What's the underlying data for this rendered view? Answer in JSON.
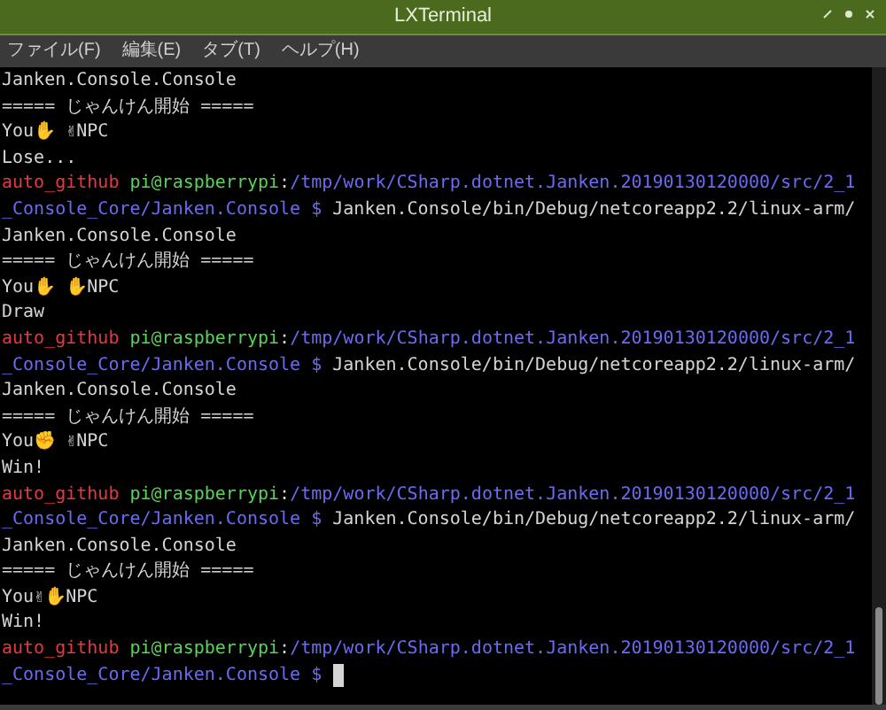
{
  "window": {
    "title": "LXTerminal"
  },
  "menu": [
    "ファイル(F)",
    "編集(E)",
    "タブ(T)",
    "ヘルプ(H)"
  ],
  "terminal": {
    "cursor": true,
    "lines": [
      [
        {
          "kind": "output",
          "text": "Janken.Console.Console"
        }
      ],
      [
        {
          "kind": "output",
          "text": "===== じゃんけん開始 ====="
        }
      ],
      [
        {
          "kind": "output",
          "text": "You✋ ✌NPC"
        }
      ],
      [
        {
          "kind": "output",
          "text": "Lose..."
        }
      ],
      [
        {
          "kind": "user",
          "text": "auto_github"
        },
        {
          "kind": "host",
          "text": "pi@raspberrypi"
        },
        {
          "kind": "output",
          "text": ":"
        },
        {
          "kind": "path",
          "text": "/tmp/work/CSharp.dotnet.Janken.20190130120000/src/2_1"
        }
      ],
      [
        {
          "kind": "path",
          "text": "_Console_Core/Janken.Console $"
        },
        {
          "kind": "command",
          "text": "Janken.Console/bin/Debug/netcoreapp2.2/linux-arm/"
        }
      ],
      [
        {
          "kind": "output",
          "text": "Janken.Console.Console"
        }
      ],
      [
        {
          "kind": "output",
          "text": "===== じゃんけん開始 ====="
        }
      ],
      [
        {
          "kind": "output",
          "text": "You✋ ✋NPC"
        }
      ],
      [
        {
          "kind": "output",
          "text": "Draw"
        }
      ],
      [
        {
          "kind": "user",
          "text": "auto_github"
        },
        {
          "kind": "host",
          "text": "pi@raspberrypi"
        },
        {
          "kind": "output",
          "text": ":"
        },
        {
          "kind": "path",
          "text": "/tmp/work/CSharp.dotnet.Janken.20190130120000/src/2_1"
        }
      ],
      [
        {
          "kind": "path",
          "text": "_Console_Core/Janken.Console $"
        },
        {
          "kind": "command",
          "text": "Janken.Console/bin/Debug/netcoreapp2.2/linux-arm/"
        }
      ],
      [
        {
          "kind": "output",
          "text": "Janken.Console.Console"
        }
      ],
      [
        {
          "kind": "output",
          "text": "===== じゃんけん開始 ====="
        }
      ],
      [
        {
          "kind": "output",
          "text": "You✊ ✌NPC"
        }
      ],
      [
        {
          "kind": "output",
          "text": "Win!"
        }
      ],
      [
        {
          "kind": "user",
          "text": "auto_github"
        },
        {
          "kind": "host",
          "text": "pi@raspberrypi"
        },
        {
          "kind": "output",
          "text": ":"
        },
        {
          "kind": "path",
          "text": "/tmp/work/CSharp.dotnet.Janken.20190130120000/src/2_1"
        }
      ],
      [
        {
          "kind": "path",
          "text": "_Console_Core/Janken.Console $"
        },
        {
          "kind": "command",
          "text": "Janken.Console/bin/Debug/netcoreapp2.2/linux-arm/"
        }
      ],
      [
        {
          "kind": "output",
          "text": "Janken.Console.Console"
        }
      ],
      [
        {
          "kind": "output",
          "text": "===== じゃんけん開始 ====="
        }
      ],
      [
        {
          "kind": "output",
          "text": "You✌✋NPC"
        }
      ],
      [
        {
          "kind": "output",
          "text": "Win!"
        }
      ],
      [
        {
          "kind": "user",
          "text": "auto_github"
        },
        {
          "kind": "host",
          "text": "pi@raspberrypi"
        },
        {
          "kind": "output",
          "text": ":"
        },
        {
          "kind": "path",
          "text": "/tmp/work/CSharp.dotnet.Janken.20190130120000/src/2_1"
        }
      ],
      [
        {
          "kind": "path",
          "text": "_Console_Core/Janken.Console $"
        }
      ]
    ]
  }
}
